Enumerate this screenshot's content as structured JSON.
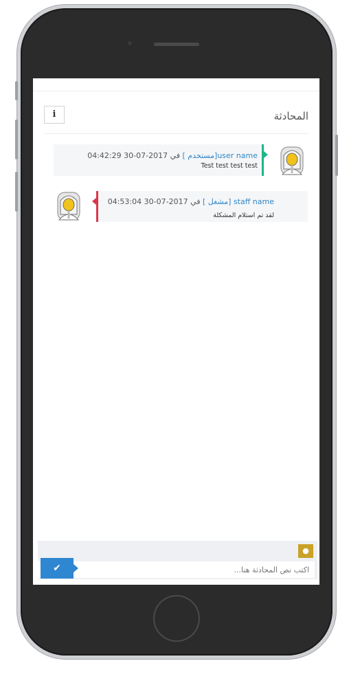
{
  "chat": {
    "title": "المحادثة",
    "info_button_label": "i"
  },
  "messages": [
    {
      "sender_name": "user name",
      "sender_role": "[مستخدم ]",
      "connector": "في",
      "timestamp": "2017-07-30 04:42:29",
      "text": "Test test test test",
      "side": "right",
      "accent_color": "#1fb58a",
      "avatar_icon": "user-avatar-icon"
    },
    {
      "sender_name": "staff name",
      "sender_role": "[مشغل ]",
      "connector": "في",
      "timestamp": "2017-07-30 04:53:04",
      "text": "لقد تم استلام المشكلة",
      "side": "left",
      "accent_color": "#d9384a",
      "avatar_icon": "staff-avatar-icon"
    }
  ],
  "compose": {
    "placeholder": "اكتب نص المحادثة هنا...",
    "send_icon": "checkmark-icon",
    "attach_icon": "attachment-icon"
  },
  "colors": {
    "primary": "#2f86d1",
    "name_link": "#2e86c9",
    "attach": "#c9a227"
  }
}
